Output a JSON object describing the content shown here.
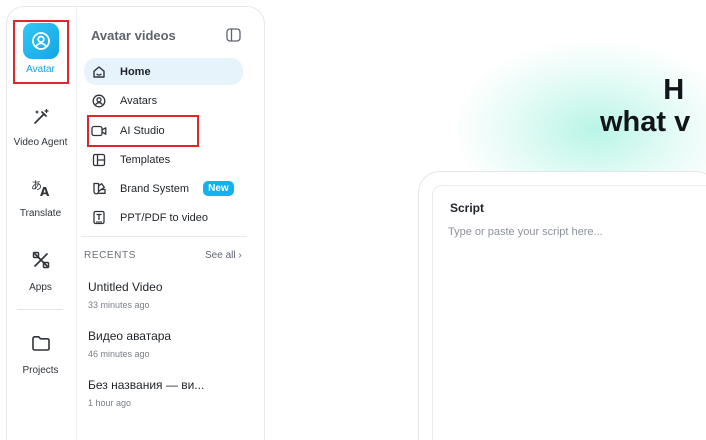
{
  "colors": {
    "accent": "#14a6e4",
    "highlight_box": "#e0262d",
    "badge": "#12b2ee",
    "glow": "#80ecd2"
  },
  "rail": {
    "items": [
      {
        "label": "Avatar",
        "icon": "avatar-icon"
      },
      {
        "label": "Video Agent",
        "icon": "magic-wand-icon"
      },
      {
        "label": "Translate",
        "icon": "translate-icon"
      },
      {
        "label": "Apps",
        "icon": "apps-icon"
      },
      {
        "label": "Projects",
        "icon": "folder-icon"
      }
    ]
  },
  "panel": {
    "title": "Avatar videos",
    "nav": [
      {
        "label": "Home",
        "icon": "home-icon"
      },
      {
        "label": "Avatars",
        "icon": "avatar-circle-icon"
      },
      {
        "label": "AI Studio",
        "icon": "video-camera-icon"
      },
      {
        "label": "Templates",
        "icon": "layout-icon"
      },
      {
        "label": "Brand System",
        "icon": "brand-icon",
        "badge": "New"
      },
      {
        "label": "PPT/PDF to video",
        "icon": "document-icon"
      }
    ],
    "recents": {
      "header": "RECENTS",
      "see_all": "See all",
      "items": [
        {
          "title": "Untitled Video",
          "time": "33 minutes ago"
        },
        {
          "title": "Видео аватара",
          "time": "46 minutes ago"
        },
        {
          "title": "Без названия — ви...",
          "time": "1 hour ago"
        }
      ]
    }
  },
  "main": {
    "heading_line1": "H",
    "heading_line2": "what v",
    "script": {
      "label": "Script",
      "placeholder": "Type or paste your script here..."
    }
  }
}
